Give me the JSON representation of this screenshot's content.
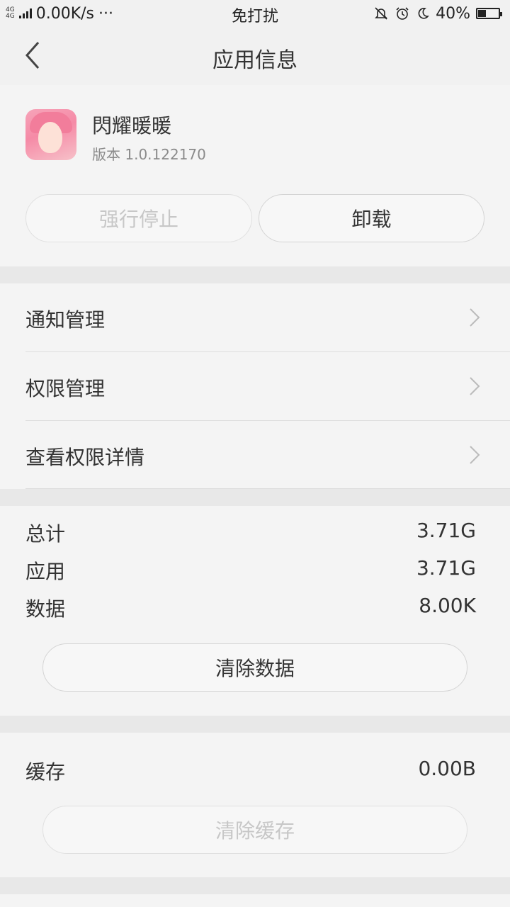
{
  "status_bar": {
    "network_type_1": "4G",
    "network_type_2": "4G",
    "speed": "0.00K/s",
    "more": "···",
    "mode": "免打扰",
    "battery": "40%",
    "battery_level": 0.4
  },
  "header": {
    "title": "应用信息"
  },
  "app": {
    "name": "閃耀暖暖",
    "version": "版本 1.0.122170",
    "force_stop_label": "强行停止",
    "uninstall_label": "卸载"
  },
  "menu": {
    "items": [
      {
        "label": "通知管理"
      },
      {
        "label": "权限管理"
      },
      {
        "label": "查看权限详情"
      }
    ]
  },
  "storage": {
    "rows": [
      {
        "key": "总计",
        "value": "3.71G"
      },
      {
        "key": "应用",
        "value": "3.71G"
      },
      {
        "key": "数据",
        "value": "8.00K"
      }
    ],
    "clear_data_label": "清除数据"
  },
  "cache": {
    "key": "缓存",
    "value": "0.00B",
    "clear_cache_label": "清除缓存"
  }
}
